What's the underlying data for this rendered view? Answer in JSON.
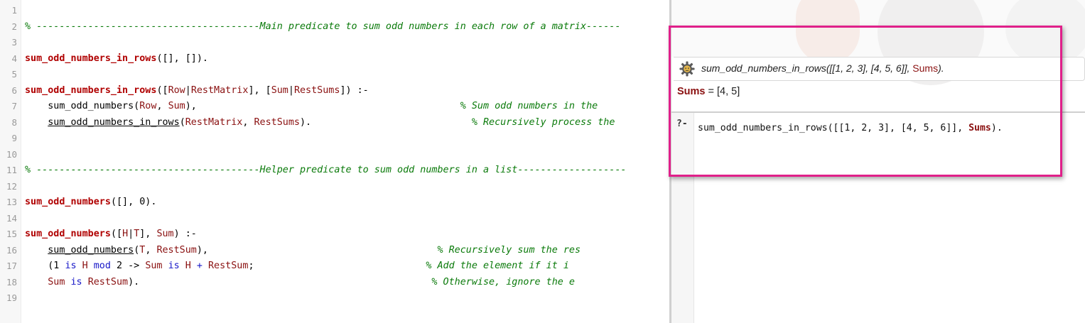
{
  "editor": {
    "lines": [
      {
        "n": "1",
        "segs": []
      },
      {
        "n": "2",
        "segs": [
          {
            "c": "cm",
            "t": "% ---------------------------------------Main predicate to sum odd numbers in each row of a matrix------"
          }
        ]
      },
      {
        "n": "3",
        "segs": []
      },
      {
        "n": "4",
        "segs": [
          {
            "c": "pred",
            "t": "sum_odd_numbers_in_rows"
          },
          {
            "c": "op",
            "t": "([], [])."
          }
        ]
      },
      {
        "n": "5",
        "segs": []
      },
      {
        "n": "6",
        "segs": [
          {
            "c": "pred",
            "t": "sum_odd_numbers_in_rows"
          },
          {
            "c": "op",
            "t": "(["
          },
          {
            "c": "var",
            "t": "Row"
          },
          {
            "c": "op",
            "t": "|"
          },
          {
            "c": "var",
            "t": "RestMatrix"
          },
          {
            "c": "op",
            "t": "], ["
          },
          {
            "c": "var",
            "t": "Sum"
          },
          {
            "c": "op",
            "t": "|"
          },
          {
            "c": "var",
            "t": "RestSums"
          },
          {
            "c": "op",
            "t": "]) :-"
          }
        ]
      },
      {
        "n": "7",
        "segs": [
          {
            "c": "op",
            "t": "    sum_odd_numbers("
          },
          {
            "c": "var",
            "t": "Row"
          },
          {
            "c": "op",
            "t": ", "
          },
          {
            "c": "var",
            "t": "Sum"
          },
          {
            "c": "op",
            "t": "),                                              "
          },
          {
            "c": "cm",
            "t": "% Sum odd numbers in the"
          }
        ]
      },
      {
        "n": "8",
        "segs": [
          {
            "c": "op",
            "t": "    "
          },
          {
            "c": "call",
            "t": "sum_odd_numbers_in_rows"
          },
          {
            "c": "op",
            "t": "("
          },
          {
            "c": "var",
            "t": "RestMatrix"
          },
          {
            "c": "op",
            "t": ", "
          },
          {
            "c": "var",
            "t": "RestSums"
          },
          {
            "c": "op",
            "t": ").                            "
          },
          {
            "c": "cm",
            "t": "% Recursively process the"
          }
        ]
      },
      {
        "n": "9",
        "segs": []
      },
      {
        "n": "10",
        "segs": []
      },
      {
        "n": "11",
        "segs": [
          {
            "c": "cm",
            "t": "% ---------------------------------------Helper predicate to sum odd numbers in a list-------------------"
          }
        ]
      },
      {
        "n": "12",
        "segs": []
      },
      {
        "n": "13",
        "segs": [
          {
            "c": "pred",
            "t": "sum_odd_numbers"
          },
          {
            "c": "op",
            "t": "([], 0)."
          }
        ]
      },
      {
        "n": "14",
        "segs": []
      },
      {
        "n": "15",
        "segs": [
          {
            "c": "pred",
            "t": "sum_odd_numbers"
          },
          {
            "c": "op",
            "t": "(["
          },
          {
            "c": "var",
            "t": "H"
          },
          {
            "c": "op",
            "t": "|"
          },
          {
            "c": "var",
            "t": "T"
          },
          {
            "c": "op",
            "t": "], "
          },
          {
            "c": "var",
            "t": "Sum"
          },
          {
            "c": "op",
            "t": ") :-"
          }
        ]
      },
      {
        "n": "16",
        "segs": [
          {
            "c": "op",
            "t": "    "
          },
          {
            "c": "call",
            "t": "sum_odd_numbers"
          },
          {
            "c": "op",
            "t": "("
          },
          {
            "c": "var",
            "t": "T"
          },
          {
            "c": "op",
            "t": ", "
          },
          {
            "c": "var",
            "t": "RestSum"
          },
          {
            "c": "op",
            "t": "),                                        "
          },
          {
            "c": "cm",
            "t": "% Recursively sum the res"
          }
        ]
      },
      {
        "n": "17",
        "segs": [
          {
            "c": "op",
            "t": "    (1 "
          },
          {
            "c": "kw",
            "t": "is"
          },
          {
            "c": "op",
            "t": " "
          },
          {
            "c": "var",
            "t": "H"
          },
          {
            "c": "op",
            "t": " "
          },
          {
            "c": "kw",
            "t": "mod"
          },
          {
            "c": "op",
            "t": " 2 -> "
          },
          {
            "c": "var",
            "t": "Sum"
          },
          {
            "c": "op",
            "t": " "
          },
          {
            "c": "kw",
            "t": "is"
          },
          {
            "c": "op",
            "t": " "
          },
          {
            "c": "var",
            "t": "H"
          },
          {
            "c": "op",
            "t": " "
          },
          {
            "c": "kw",
            "t": "+"
          },
          {
            "c": "op",
            "t": " "
          },
          {
            "c": "var",
            "t": "RestSum"
          },
          {
            "c": "op",
            "t": ";                              "
          },
          {
            "c": "cm",
            "t": "% Add the element if it i"
          }
        ]
      },
      {
        "n": "18",
        "segs": [
          {
            "c": "op",
            "t": "    "
          },
          {
            "c": "var",
            "t": "Sum"
          },
          {
            "c": "op",
            "t": " "
          },
          {
            "c": "kw",
            "t": "is"
          },
          {
            "c": "op",
            "t": " "
          },
          {
            "c": "var",
            "t": "RestSum"
          },
          {
            "c": "op",
            "t": ").                                                   "
          },
          {
            "c": "cm",
            "t": "% Otherwise, ignore the e"
          }
        ]
      },
      {
        "n": "19",
        "segs": []
      }
    ]
  },
  "query": {
    "pred": "sum_odd_numbers_in_rows([[1, 2, 3], [4, 5, 6]], ",
    "var": "Sums",
    "end": ")."
  },
  "answer": {
    "var": "Sums",
    "rest": " = [4, 5]"
  },
  "prompt": "?-",
  "input": {
    "pred": "sum_odd_numbers_in_rows([[1, 2, 3], [4, 5, 6]], ",
    "var": "Sums",
    "end": ")."
  },
  "colors": {
    "highlight": "#e0208a",
    "variable": "#8a1010",
    "comment": "#0a7a0a",
    "keyword": "#1818c8"
  }
}
